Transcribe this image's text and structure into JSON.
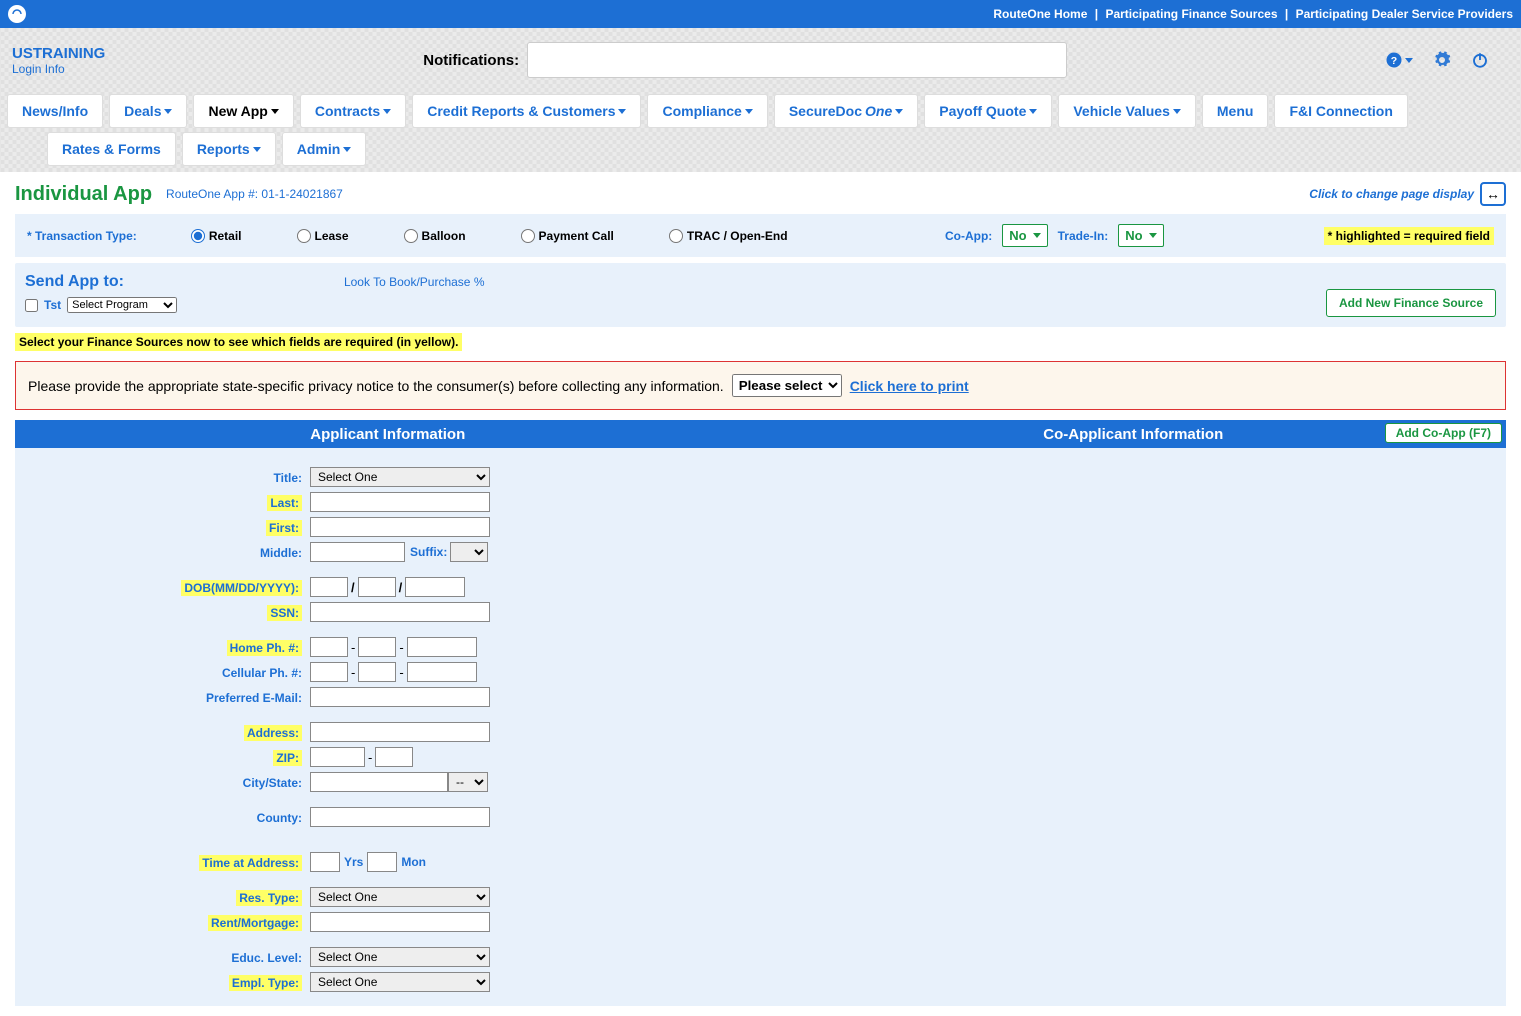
{
  "topbar": {
    "links": [
      "RouteOne Home",
      "Participating Finance Sources",
      "Participating Dealer Service Providers"
    ]
  },
  "header": {
    "org": "USTRAINING",
    "login_info": "Login Info",
    "notifications_label": "Notifications:"
  },
  "nav": {
    "row1": [
      "News/Info",
      "Deals",
      "New App",
      "Contracts",
      "Credit Reports & Customers",
      "Compliance",
      "SecureDoc",
      "Payoff Quote",
      "Vehicle Values",
      "Menu",
      "F&I Connection"
    ],
    "securedoc_suffix": "One",
    "row2": [
      "Rates & Forms",
      "Reports",
      "Admin"
    ],
    "active": "New App"
  },
  "page": {
    "title": "Individual App",
    "app_id": "RouteOne App #: 01-1-24021867",
    "display_toggle": "Click to change page display",
    "toggle_icon": "↔"
  },
  "transaction": {
    "label": "* Transaction Type:",
    "options": [
      "Retail",
      "Lease",
      "Balloon",
      "Payment Call",
      "TRAC / Open-End"
    ],
    "selected": "Retail",
    "coapp_label": "Co-App:",
    "coapp_value": "No",
    "tradein_label": "Trade-In:",
    "tradein_value": "No",
    "required_note": "* highlighted = required field"
  },
  "sendapp": {
    "title": "Send App to:",
    "look_to_book": "Look To Book/Purchase %",
    "tst_label": "Tst",
    "program_placeholder": "Select Program",
    "sources_note": "Select your Finance Sources now to see which fields are required (in yellow).",
    "add_button": "Add New Finance Source"
  },
  "privacy": {
    "text": "Please provide the appropriate state-specific privacy notice to the consumer(s) before collecting any information.",
    "select_placeholder": "Please select",
    "print_link": "Click here to print"
  },
  "applicant": {
    "header_left": "Applicant Information",
    "header_right": "Co-Applicant Information",
    "add_coapp": "Add Co-App  (F7)"
  },
  "form": {
    "title": "Title:",
    "title_opt": "Select One",
    "last": "Last:",
    "first": "First:",
    "middle": "Middle:",
    "suffix": "Suffix:",
    "dob": "DOB(MM/DD/YYYY):",
    "ssn": "SSN:",
    "home_ph": "Home Ph. #:",
    "cell_ph": "Cellular Ph. #:",
    "email": "Preferred E-Mail:",
    "address": "Address:",
    "zip": "ZIP:",
    "city_state": "City/State:",
    "state_opt": "--",
    "county": "County:",
    "time_addr": "Time at Address:",
    "yrs": "Yrs",
    "mon": "Mon",
    "res_type": "Res. Type:",
    "rent": "Rent/Mortgage:",
    "educ": "Educ. Level:",
    "empl": "Empl. Type:",
    "select_one": "Select One"
  }
}
